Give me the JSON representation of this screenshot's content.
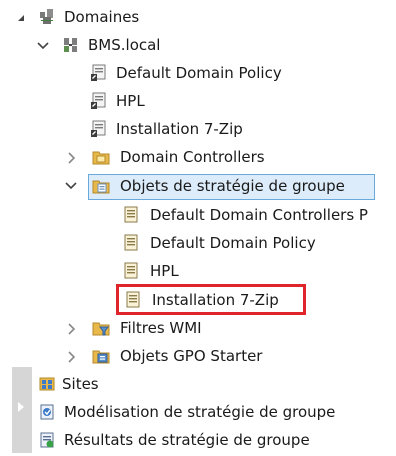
{
  "tree": {
    "domains": {
      "label": "Domaines",
      "icon": "domains-icon",
      "expanded": true
    },
    "domain": {
      "label": "BMS.local",
      "icon": "domain-icon",
      "expanded": true
    },
    "linked_gpos": [
      {
        "label": "Default Domain Policy",
        "icon": "gpo-link-icon"
      },
      {
        "label": "HPL",
        "icon": "gpo-link-icon"
      },
      {
        "label": "Installation 7-Zip",
        "icon": "gpo-link-icon"
      }
    ],
    "domain_controllers": {
      "label": "Domain Controllers",
      "icon": "ou-folder-icon",
      "expanded": false
    },
    "gpo_container": {
      "label": "Objets de stratégie de groupe",
      "icon": "gpo-folder-icon",
      "expanded": true,
      "selected": true
    },
    "gpos": [
      {
        "label": "Default Domain Controllers P",
        "icon": "gpo-icon"
      },
      {
        "label": "Default Domain Policy",
        "icon": "gpo-icon"
      },
      {
        "label": "HPL",
        "icon": "gpo-icon"
      },
      {
        "label": "Installation 7-Zip",
        "icon": "gpo-icon",
        "highlighted": true
      }
    ],
    "wmi_filters": {
      "label": "Filtres WMI",
      "icon": "wmi-filter-icon",
      "expanded": false
    },
    "starter_gpos": {
      "label": "Objets GPO Starter",
      "icon": "starter-gpo-icon",
      "expanded": false
    },
    "sites": {
      "label": "Sites",
      "icon": "sites-icon"
    },
    "modeling": {
      "label": "Modélisation de stratégie de groupe",
      "icon": "modeling-icon"
    },
    "results": {
      "label": "Résultats de stratégie de groupe",
      "icon": "results-icon"
    }
  },
  "colors": {
    "selection_fill": "#dcecfa",
    "selection_border": "#6aa9dc",
    "highlight_border": "#e0242b",
    "folder": "#e8b84a"
  }
}
